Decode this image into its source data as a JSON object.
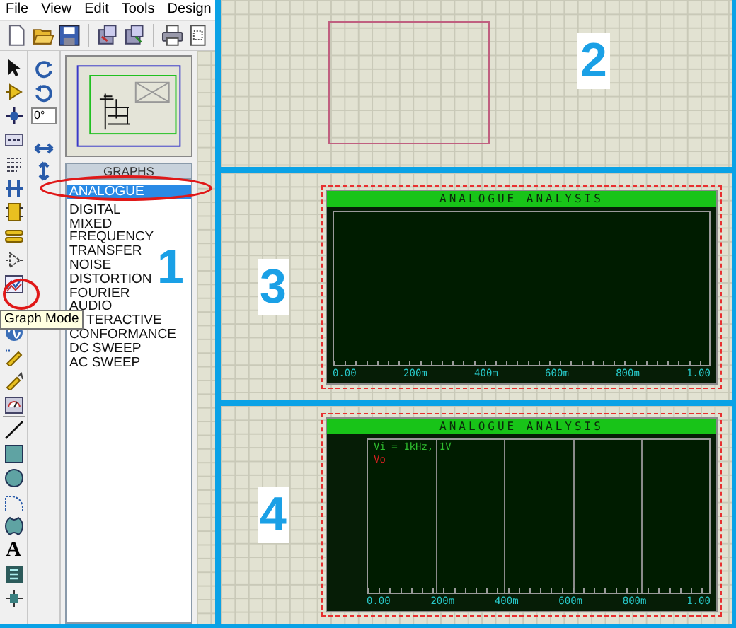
{
  "menu": [
    "File",
    "View",
    "Edit",
    "Tools",
    "Design"
  ],
  "rotation_field": {
    "value": "0°"
  },
  "device_panel": {
    "title": "GRAPHS",
    "items": [
      {
        "label": "ANALOGUE",
        "selected": true
      },
      {
        "label": "DIGITAL",
        "selected": false
      },
      {
        "label": "MIXED",
        "selected": false
      },
      {
        "label": "FREQUENCY",
        "selected": false
      },
      {
        "label": "TRANSFER",
        "selected": false
      },
      {
        "label": "NOISE",
        "selected": false
      },
      {
        "label": "DISTORTION",
        "selected": false
      },
      {
        "label": "FOURIER",
        "selected": false
      },
      {
        "label": "AUDIO",
        "selected": false
      },
      {
        "label": "TERACTIVE",
        "selected": false,
        "partly_hidden": true
      },
      {
        "label": "CONFORMANCE",
        "selected": false
      },
      {
        "label": "DC SWEEP",
        "selected": false
      },
      {
        "label": "AC SWEEP",
        "selected": false
      }
    ]
  },
  "tooltip": "Graph Mode",
  "text_tool": "A",
  "left_callout": "1",
  "panels": [
    {
      "kind": "placement",
      "callout": "2"
    },
    {
      "kind": "graph",
      "callout": "3",
      "graph": {
        "title": "ANALOGUE ANALYSIS",
        "gridlines": false,
        "x_labels": [
          "0.00",
          "200m",
          "400m",
          "600m",
          "800m",
          "1.00"
        ]
      }
    },
    {
      "kind": "graph",
      "callout": "4",
      "graph": {
        "title": "ANALOGUE ANALYSIS",
        "gridlines": true,
        "x_labels": [
          "0.00",
          "200m",
          "400m",
          "600m",
          "800m",
          "1.00"
        ],
        "traces": [
          {
            "label": "Vi = 1kHz, 1V",
            "color": "#2ebd2e"
          },
          {
            "label": "Vo",
            "color": "#d42020"
          }
        ]
      }
    }
  ]
}
